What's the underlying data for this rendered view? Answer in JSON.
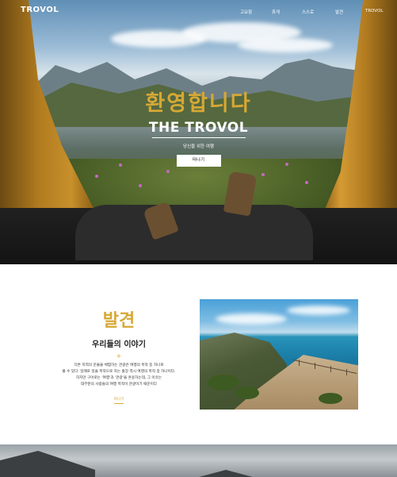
{
  "nav": {
    "logo": "TROVOL",
    "items": [
      {
        "label": "고요함"
      },
      {
        "label": "휴게"
      },
      {
        "label": "스스로"
      },
      {
        "label": "발견"
      },
      {
        "label": "TROVOL"
      }
    ]
  },
  "hero": {
    "korean_title": "환영합니다",
    "brand": "THE TROVOL",
    "subtitle": "당신을 위한 여행",
    "button_label": "떠나기"
  },
  "story": {
    "korean_title": "발견",
    "title": "우리들의 이야기",
    "plus": "+",
    "body_lines": [
      "다른 지역의 문물을 체험하는 관광은 여행의 목적 중 하나로",
      "볼 수 있다. 일례로 일을 목적으로 하는 출장 역시 여행의 목적 중 하나이다.",
      "하지만 구어로는 '여행'과 '관광'을 혼용하는데, 그 이유는",
      "대부분의 사람들의 여행 목적이 관광이기 때문이다"
    ],
    "link_label": "떠나기"
  },
  "colors": {
    "accent": "#d6a835",
    "text": "#222222",
    "background": "#ffffff"
  }
}
